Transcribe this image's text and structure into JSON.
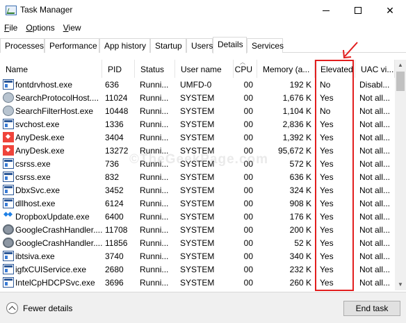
{
  "window": {
    "title": "Task Manager",
    "minimize": "minimize",
    "maximize": "maximize",
    "close": "✕"
  },
  "menu": [
    "File",
    "Options",
    "View"
  ],
  "menu_underline": [
    "F",
    "O",
    "V"
  ],
  "tabs": [
    "Processes",
    "Performance",
    "App history",
    "Startup",
    "Users",
    "Details",
    "Services"
  ],
  "active_tab": "Details",
  "columns": {
    "name": "Name",
    "pid": "PID",
    "status": "Status",
    "user": "User name",
    "cpu": "CPU",
    "memory": "Memory (a...",
    "elevated": "Elevated",
    "uac": "UAC vi..."
  },
  "rows": [
    {
      "icon": "window-app-icon",
      "name": "fontdrvhost.exe",
      "pid": "636",
      "status": "Runni...",
      "user": "UMFD-0",
      "cpu": "00",
      "memory": "192 K",
      "elevated": "No",
      "uac": "Disabl..."
    },
    {
      "icon": "search-app-icon",
      "name": "SearchProtocolHost....",
      "pid": "11024",
      "status": "Runni...",
      "user": "SYSTEM",
      "cpu": "00",
      "memory": "1,676 K",
      "elevated": "Yes",
      "uac": "Not all..."
    },
    {
      "icon": "search-app-icon",
      "name": "SearchFilterHost.exe",
      "pid": "10448",
      "status": "Runni...",
      "user": "SYSTEM",
      "cpu": "00",
      "memory": "1,104 K",
      "elevated": "No",
      "uac": "Not all..."
    },
    {
      "icon": "window-app-icon",
      "name": "svchost.exe",
      "pid": "1336",
      "status": "Runni...",
      "user": "SYSTEM",
      "cpu": "00",
      "memory": "2,836 K",
      "elevated": "Yes",
      "uac": "Not all..."
    },
    {
      "icon": "anydesk-icon",
      "name": "AnyDesk.exe",
      "pid": "3404",
      "status": "Runni...",
      "user": "SYSTEM",
      "cpu": "00",
      "memory": "1,392 K",
      "elevated": "Yes",
      "uac": "Not all..."
    },
    {
      "icon": "anydesk-icon",
      "name": "AnyDesk.exe",
      "pid": "13272",
      "status": "Runni...",
      "user": "SYSTEM",
      "cpu": "00",
      "memory": "95,672 K",
      "elevated": "Yes",
      "uac": "Not all..."
    },
    {
      "icon": "window-app-icon",
      "name": "csrss.exe",
      "pid": "736",
      "status": "Runni...",
      "user": "SYSTEM",
      "cpu": "00",
      "memory": "572 K",
      "elevated": "Yes",
      "uac": "Not all..."
    },
    {
      "icon": "window-app-icon",
      "name": "csrss.exe",
      "pid": "832",
      "status": "Runni...",
      "user": "SYSTEM",
      "cpu": "00",
      "memory": "636 K",
      "elevated": "Yes",
      "uac": "Not all..."
    },
    {
      "icon": "window-app-icon",
      "name": "DbxSvc.exe",
      "pid": "3452",
      "status": "Runni...",
      "user": "SYSTEM",
      "cpu": "00",
      "memory": "324 K",
      "elevated": "Yes",
      "uac": "Not all..."
    },
    {
      "icon": "window-app-icon",
      "name": "dllhost.exe",
      "pid": "6124",
      "status": "Runni...",
      "user": "SYSTEM",
      "cpu": "00",
      "memory": "908 K",
      "elevated": "Yes",
      "uac": "Not all..."
    },
    {
      "icon": "dropbox-icon",
      "name": "DropboxUpdate.exe",
      "pid": "6400",
      "status": "Runni...",
      "user": "SYSTEM",
      "cpu": "00",
      "memory": "176 K",
      "elevated": "Yes",
      "uac": "Not all..."
    },
    {
      "icon": "gear-app-icon",
      "name": "GoogleCrashHandler....",
      "pid": "11708",
      "status": "Runni...",
      "user": "SYSTEM",
      "cpu": "00",
      "memory": "200 K",
      "elevated": "Yes",
      "uac": "Not all..."
    },
    {
      "icon": "gear-app-icon",
      "name": "GoogleCrashHandler....",
      "pid": "11856",
      "status": "Runni...",
      "user": "SYSTEM",
      "cpu": "00",
      "memory": "52 K",
      "elevated": "Yes",
      "uac": "Not all..."
    },
    {
      "icon": "window-app-icon",
      "name": "ibtsiva.exe",
      "pid": "3740",
      "status": "Runni...",
      "user": "SYSTEM",
      "cpu": "00",
      "memory": "340 K",
      "elevated": "Yes",
      "uac": "Not all..."
    },
    {
      "icon": "window-app-icon",
      "name": "igfxCUIService.exe",
      "pid": "2680",
      "status": "Runni...",
      "user": "SYSTEM",
      "cpu": "00",
      "memory": "232 K",
      "elevated": "Yes",
      "uac": "Not all..."
    },
    {
      "icon": "window-app-icon",
      "name": "IntelCpHDCPSvc.exe",
      "pid": "3696",
      "status": "Runni...",
      "user": "SYSTEM",
      "cpu": "00",
      "memory": "260 K",
      "elevated": "Yes",
      "uac": "Not all..."
    }
  ],
  "watermark": "©TheGeekPage.com",
  "footer": {
    "fewer_details": "Fewer details",
    "end_task": "End task"
  },
  "colors": {
    "highlight": "#e21e1e",
    "border": "#d9d9d9",
    "footer_bg": "#f0f0f0"
  }
}
